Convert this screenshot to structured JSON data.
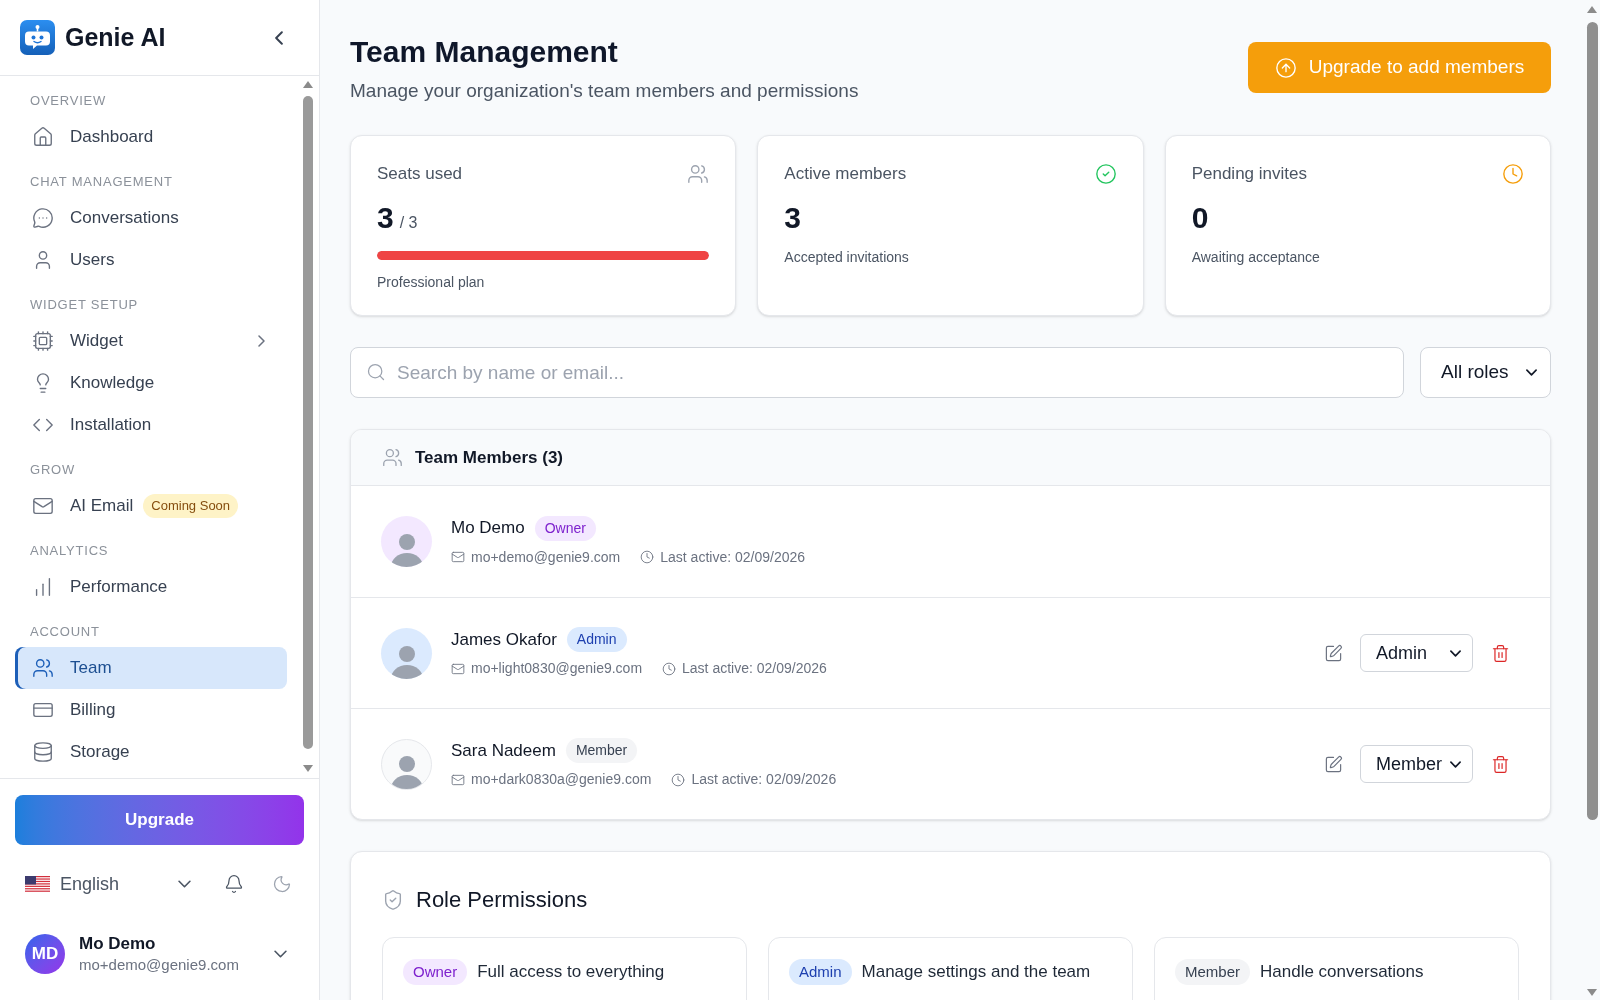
{
  "sidebar": {
    "brand": "Genie AI",
    "sections": [
      {
        "heading": "OVERVIEW",
        "items": [
          {
            "label": "Dashboard",
            "selected": false
          }
        ]
      },
      {
        "heading": "CHAT MANAGEMENT",
        "items": [
          {
            "label": "Conversations",
            "selected": false
          },
          {
            "label": "Users",
            "selected": false
          }
        ]
      },
      {
        "heading": "WIDGET SETUP",
        "items": [
          {
            "label": "Widget",
            "selected": false,
            "expanded": false
          },
          {
            "label": "Knowledge",
            "selected": false
          },
          {
            "label": "Installation",
            "selected": false
          }
        ]
      },
      {
        "heading": "GROW",
        "items": [
          {
            "label": "AI Email",
            "selected": false,
            "badge": "Coming Soon"
          }
        ]
      },
      {
        "heading": "ANALYTICS",
        "items": [
          {
            "label": "Performance",
            "selected": false
          }
        ]
      },
      {
        "heading": "ACCOUNT",
        "items": [
          {
            "label": "Team",
            "selected": true
          },
          {
            "label": "Billing",
            "selected": false
          },
          {
            "label": "Storage",
            "selected": false
          }
        ]
      }
    ],
    "upgrade_button": "Upgrade",
    "language": "English",
    "user": {
      "initials": "MD",
      "name": "Mo Demo",
      "email": "mo+demo@genie9.com"
    }
  },
  "header": {
    "title": "Team Management",
    "subtitle": "Manage your organization's team members and permissions",
    "action": "Upgrade to add members"
  },
  "stats": [
    {
      "label": "Seats used",
      "value": "3",
      "total": "/ 3",
      "level": 1,
      "note": "Professional plan"
    },
    {
      "label": "Active members",
      "value": "3",
      "note": "Accepted invitations"
    },
    {
      "label": "Pending invites",
      "value": "0",
      "note": "Awaiting acceptance"
    }
  ],
  "search": {
    "placeholder": "Search by name or email..."
  },
  "role_filter": {
    "value": "All roles"
  },
  "team": {
    "title": "Team Members (3)",
    "members": [
      {
        "name": "Mo Demo",
        "role": "Owner",
        "kind": "owner",
        "email": "mo+demo@genie9.com",
        "last_active": "Last active: 02/09/2026"
      },
      {
        "name": "James Okafor",
        "role": "Admin",
        "kind": "admin",
        "email": "mo+light0830@genie9.com",
        "last_active": "Last active: 02/09/2026",
        "role_select": "Admin"
      },
      {
        "name": "Sara Nadeem",
        "role": "Member",
        "kind": "member",
        "email": "mo+dark0830a@genie9.com",
        "last_active": "Last active: 02/09/2026",
        "role_select": "Member"
      }
    ]
  },
  "permissions": {
    "title": "Role Permissions",
    "roles": [
      {
        "badge": "Owner",
        "kind": "owner",
        "summary": "Full access to everything"
      },
      {
        "badge": "Admin",
        "kind": "admin",
        "summary": "Manage settings and the team"
      },
      {
        "badge": "Member",
        "kind": "member",
        "summary": "Handle conversations"
      }
    ]
  }
}
